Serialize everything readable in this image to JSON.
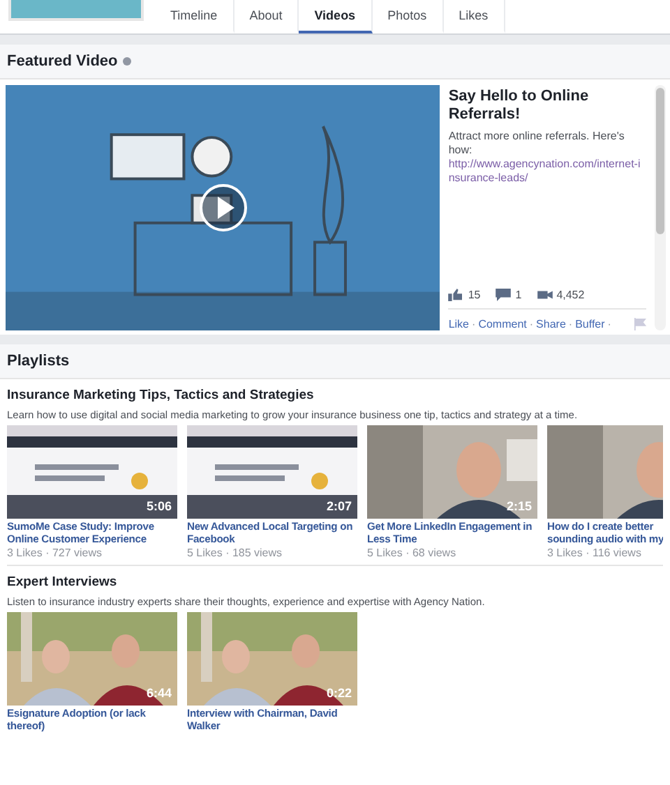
{
  "tabs": [
    {
      "label": "Timeline",
      "selected": false
    },
    {
      "label": "About",
      "selected": false
    },
    {
      "label": "Videos",
      "selected": true
    },
    {
      "label": "Photos",
      "selected": false
    },
    {
      "label": "Likes",
      "selected": false
    }
  ],
  "featured": {
    "heading": "Featured Video",
    "title": "Say Hello to Online Referrals!",
    "description": "Attract more online referrals. Here's how:",
    "link": "http://www.agencynation.com/internet-insurance-leads/",
    "likes": "15",
    "comments": "1",
    "views": "4,452",
    "actions": [
      "Like",
      "Comment",
      "Share",
      "Buffer"
    ],
    "separator": "·"
  },
  "playlists_heading": "Playlists",
  "playlists": [
    {
      "title": "Insurance Marketing Tips, Tactics and Strategies",
      "description": "Learn how to use digital and social media marketing to grow your insurance business one tip, tactics and strategy at a time.",
      "videos": [
        {
          "title": "SumoMe Case Study: Improve Online Customer Experience",
          "duration": "5:06",
          "meta": "3 Likes · 727 views",
          "kind": "screen"
        },
        {
          "title": "New Advanced Local Targeting on Facebook",
          "duration": "2:07",
          "meta": "5 Likes · 185 views",
          "kind": "screen"
        },
        {
          "title": "Get More LinkedIn Engagement in Less Time",
          "duration": "2:15",
          "meta": "5 Likes · 68 views",
          "kind": "room"
        },
        {
          "title": "How do I create better sounding audio with my",
          "meta": "3 Likes · 116 views",
          "kind": "room"
        }
      ]
    },
    {
      "title": "Expert Interviews",
      "description": "Listen to insurance industry experts share their thoughts, experience and expertise with Agency Nation.",
      "videos": [
        {
          "title": "Esignature Adoption (or lack thereof)",
          "duration": "6:44",
          "kind": "outdoor"
        },
        {
          "title": "Interview with Chairman, David Walker",
          "duration": "0:22",
          "kind": "outdoor"
        }
      ]
    }
  ]
}
